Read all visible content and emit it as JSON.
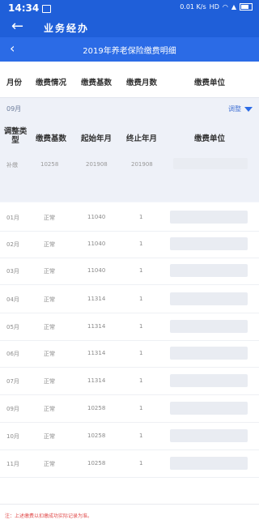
{
  "status_bar": {
    "time": "14:34",
    "net_speed": "0.01 K/s",
    "hd": "HD"
  },
  "app_bar": {
    "title": "业务经办",
    "back_icon": "arrow-left-icon"
  },
  "sub_bar": {
    "title": "2019年养老保险缴费明细",
    "back_icon": "chevron-left-icon"
  },
  "columns": [
    "月份",
    "缴费情况",
    "缴费基数",
    "缴费月数",
    "缴费单位"
  ],
  "month_group": {
    "month": "09月",
    "adjust_label": "调整"
  },
  "adjust_columns": {
    "type": "调整类型",
    "base": "缴费基数",
    "start": "起始年月",
    "end": "终止年月",
    "unit": "缴费单位"
  },
  "adjust_row": {
    "type": "补缴",
    "base": "10258",
    "start": "201908",
    "end": "201908"
  },
  "rows": [
    {
      "month": "01月",
      "status": "正常",
      "base": "11040",
      "count": "1"
    },
    {
      "month": "02月",
      "status": "正常",
      "base": "11040",
      "count": "1"
    },
    {
      "month": "03月",
      "status": "正常",
      "base": "11040",
      "count": "1"
    },
    {
      "month": "04月",
      "status": "正常",
      "base": "11314",
      "count": "1"
    },
    {
      "month": "05月",
      "status": "正常",
      "base": "11314",
      "count": "1"
    },
    {
      "month": "06月",
      "status": "正常",
      "base": "11314",
      "count": "1"
    },
    {
      "month": "07月",
      "status": "正常",
      "base": "11314",
      "count": "1"
    },
    {
      "month": "09月",
      "status": "正常",
      "base": "10258",
      "count": "1"
    },
    {
      "month": "10月",
      "status": "正常",
      "base": "10258",
      "count": "1"
    },
    {
      "month": "11月",
      "status": "正常",
      "base": "10258",
      "count": "1"
    }
  ],
  "note": "注：上述缴费以扣缴成功实际记录为准。"
}
